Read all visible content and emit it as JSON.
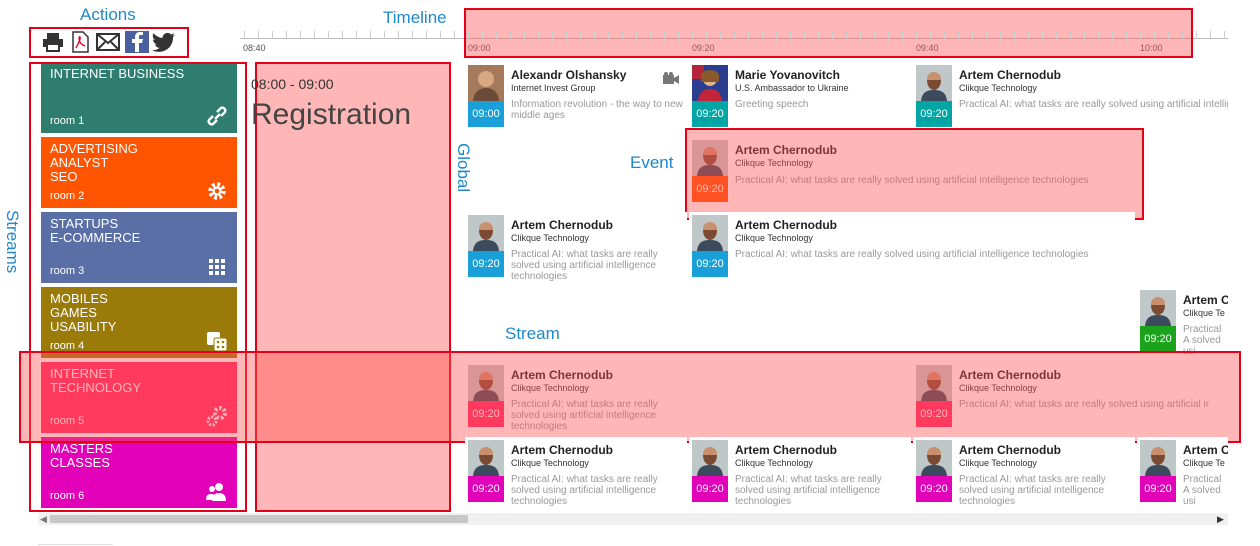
{
  "annotations": {
    "actions": "Actions",
    "timeline": "Timeline",
    "streams": "Streams",
    "global": "Global",
    "event": "Event",
    "stream": "Stream"
  },
  "actions": [
    {
      "name": "print-icon"
    },
    {
      "name": "pdf-icon"
    },
    {
      "name": "email-icon"
    },
    {
      "name": "facebook-icon"
    },
    {
      "name": "twitter-icon"
    }
  ],
  "timeline": {
    "ticks": [
      "08:40",
      "09:00",
      "09:20",
      "09:40",
      "10:00"
    ]
  },
  "streams": [
    {
      "title": "INTERNET BUSINESS",
      "room": "room 1",
      "color": "#2e7d6e",
      "icon": "link-icon"
    },
    {
      "title": "ADVERTISING\nANALYST\nSEO",
      "room": "room 2",
      "color": "#ff5400",
      "icon": "gear-icon"
    },
    {
      "title": "STARTUPS\nE-COMMERCE",
      "room": "room 3",
      "color": "#5a6fa6",
      "icon": "grid-icon"
    },
    {
      "title": "MOBILES\nGAMES\nUSABILITY",
      "room": "room 4",
      "color": "#9a7a08",
      "icon": "dice-icon"
    },
    {
      "title": "INTERNET\nTECHNOLOGY",
      "room": "room 5",
      "color": "#ff2a68",
      "icon": "gears-icon"
    },
    {
      "title": "MASTERS\nCLASSES",
      "room": "room 6",
      "color": "#e200b8",
      "icon": "users-icon"
    }
  ],
  "global_event": {
    "time": "08:00 - 09:00",
    "title": "Registration"
  },
  "events": [
    {
      "name": "Alexandr Olshansky",
      "org": "Internet Invest Group",
      "desc": "Information revolution - the way to new middle ages",
      "time": "09:00",
      "color": "#1aa0d8",
      "video": true
    },
    {
      "name": "Marie Yovanovitch",
      "org": "U.S. Ambassador to Ukraine",
      "desc": "Greeting speech",
      "time": "09:20",
      "color": "#00a6a6"
    },
    {
      "name": "Artem Chernodub",
      "org": "Clikque Technology",
      "desc": "Practical AI: what tasks are really solved using artificial intelligence technologies",
      "time": "09:20",
      "color": "#00a6a6"
    },
    {
      "name": "Artem Chernodub",
      "org": "Clikque Technology",
      "desc": "Practical AI: what tasks are really solved using artificial intelligence technologies",
      "time": "09:20",
      "color": "#ff5400"
    },
    {
      "name": "Artem Chernodub",
      "org": "Clikque Technology",
      "desc": "Practical AI: what tasks are really solved using artificial intelligence technologies",
      "time": "09:20",
      "color": "#1aa0d8"
    },
    {
      "name": "Artem Chernodub",
      "org": "Clikque Technology",
      "desc": "Practical AI: what tasks are really solved using artificial intelligence technologies",
      "time": "09:20",
      "color": "#1aa0d8"
    },
    {
      "name": "Artem C",
      "org": "Clikque Te",
      "desc": "Practical A solved usi",
      "time": "09:20",
      "color": "#1ca31c"
    },
    {
      "name": "Artem Chernodub",
      "org": "Clikque Technology",
      "desc": "Practical AI: what tasks are really solved using artificial intelligence technologies",
      "time": "09:20",
      "color": "#ff2a68"
    },
    {
      "name": "Artem Chernodub",
      "org": "Clikque Technology",
      "desc": "Practical AI: what tasks are really solved using artificial ir",
      "time": "09:20",
      "color": "#ff2a68"
    },
    {
      "name": "Artem Chernodub",
      "org": "Clikque Technology",
      "desc": "Practical AI: what tasks are really solved using artificial intelligence technologies",
      "time": "09:20",
      "color": "#e200b8"
    },
    {
      "name": "Artem Chernodub",
      "org": "Clikque Technology",
      "desc": "Practical AI: what tasks are really solved using artificial intelligence technologies",
      "time": "09:20",
      "color": "#e200b8"
    },
    {
      "name": "Artem Chernodub",
      "org": "Clikque Technology",
      "desc": "Practical AI: what tasks are really solved using artificial intelligence technologies",
      "time": "09:20",
      "color": "#e200b8"
    },
    {
      "name": "Artem C",
      "org": "Clikque Te",
      "desc": "Practical A solved usi",
      "time": "09:20",
      "color": "#e200b8"
    }
  ]
}
